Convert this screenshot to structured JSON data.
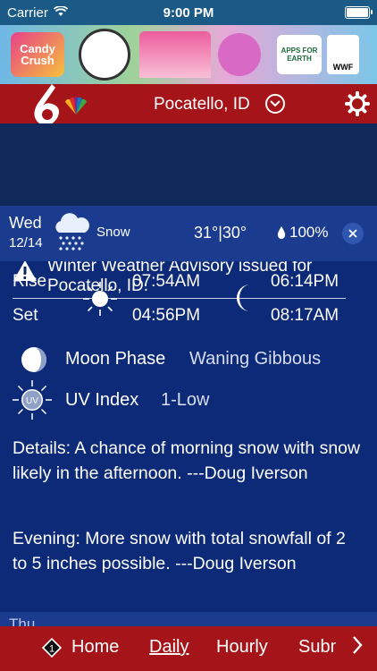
{
  "status_bar": {
    "carrier": "Carrier",
    "time": "9:00 PM"
  },
  "banner": {
    "candy_text": "Candy Crush",
    "apps_text": "APPS FOR EARTH",
    "wwf_text": "WWF"
  },
  "location": {
    "name": "Pocatello, ID"
  },
  "alert": {
    "text": "Winter Weather Advisory issued for Pocatello, ID."
  },
  "day": {
    "name": "Wed",
    "date": "12/14",
    "condition": "Snow",
    "temps": "31°|30°",
    "precip": "100%"
  },
  "sun_moon": {
    "rise_label": "Rise",
    "set_label": "Set",
    "sunrise": "07:54AM",
    "sunset": "04:56PM",
    "moonrise": "06:14PM",
    "moonset": "08:17AM"
  },
  "moon_phase": {
    "label": "Moon Phase",
    "value": "Waning Gibbous"
  },
  "uv": {
    "icon_text": "UV",
    "label": "UV Index",
    "value": "1-Low"
  },
  "details": "Details: A chance of morning snow with snow likely in the afternoon. ---Doug Iverson",
  "evening": "Evening: More snow with total snowfall of 2 to 5 inches possible. ---Doug Iverson",
  "next_day_partial": "Thu",
  "tabs": {
    "home_number": "1",
    "home": "Home",
    "daily": "Daily",
    "hourly": "Hourly",
    "submit": "Submit"
  },
  "colors": {
    "header_red": "#a41419",
    "body_blue": "#0d2a78",
    "alert_bg": "#0f2a5a",
    "row_blue": "#1a3b8e"
  }
}
